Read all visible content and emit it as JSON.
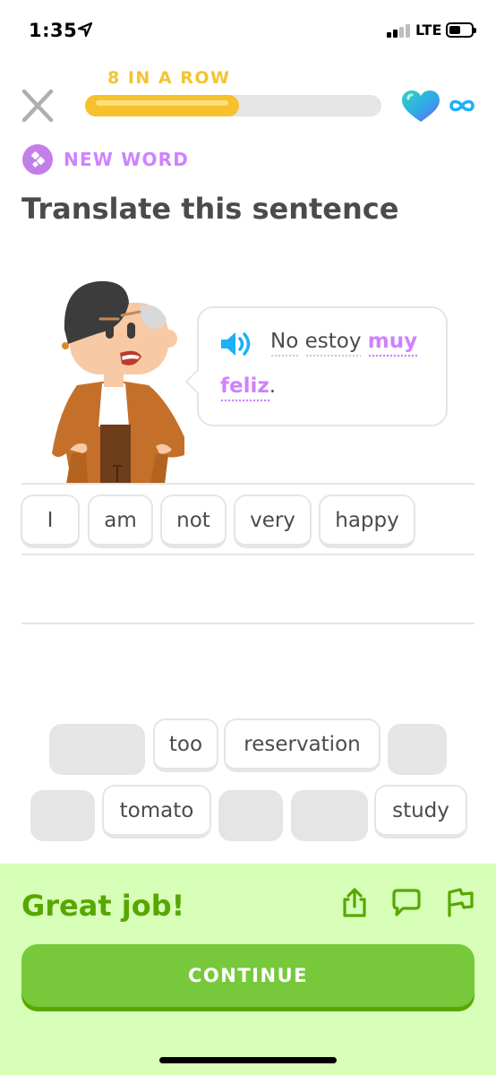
{
  "status_bar": {
    "time": "1:35",
    "network": "LTE",
    "icons": [
      "location-arrow-icon",
      "signal-icon",
      "battery-icon"
    ]
  },
  "header": {
    "streak_label": "8 IN A ROW",
    "progress_percent": 52,
    "hearts": "infinite",
    "colors": {
      "progress": "#f7c02d",
      "streak": "#f2c531",
      "track": "#e5e5e5"
    }
  },
  "lesson": {
    "badge_label": "NEW WORD",
    "instruction": "Translate this sentence",
    "prompt_tokens": [
      {
        "text": "No",
        "new": false
      },
      {
        "text": "estoy",
        "new": false
      },
      {
        "text": "muy",
        "new": true
      },
      {
        "text": "feliz",
        "new": true
      }
    ],
    "prompt_punct": ".",
    "colors": {
      "new_word": "#ce82ff"
    }
  },
  "answer": {
    "selected_words": [
      "I",
      "am",
      "not",
      "very",
      "happy"
    ]
  },
  "word_bank": {
    "row1": [
      {
        "label": "",
        "used": true
      },
      {
        "label": "too",
        "used": false
      },
      {
        "label": "reservation",
        "used": false
      },
      {
        "label": "",
        "used": true
      }
    ],
    "row2": [
      {
        "label": "",
        "used": true
      },
      {
        "label": "tomato",
        "used": false
      },
      {
        "label": "",
        "used": true
      },
      {
        "label": "",
        "used": true
      },
      {
        "label": "study",
        "used": false
      }
    ]
  },
  "footer": {
    "message": "Great job!",
    "icons": [
      "share-icon",
      "comment-icon",
      "report-flag-icon"
    ],
    "continue_label": "CONTINUE",
    "colors": {
      "background": "#d7ffb8",
      "message": "#58a700",
      "button": "#78c83c"
    }
  }
}
